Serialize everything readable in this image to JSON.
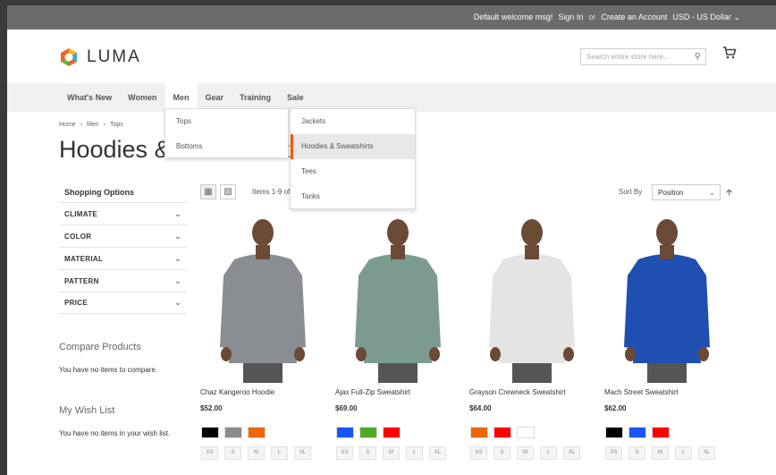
{
  "topbar": {
    "welcome": "Default welcome msg!",
    "sign_in": "Sign In",
    "or": "or",
    "create_account": "Create an Account",
    "currency": "USD - US Dollar"
  },
  "header": {
    "logo_text": "LUMA",
    "search_placeholder": "Search entire store here...",
    "logo_colors": [
      "#f26322",
      "#38a9e4",
      "#6cb33f",
      "#f6b91a"
    ]
  },
  "nav": {
    "items": [
      {
        "label": "What's New"
      },
      {
        "label": "Women"
      },
      {
        "label": "Men"
      },
      {
        "label": "Gear"
      },
      {
        "label": "Training"
      },
      {
        "label": "Sale"
      }
    ],
    "active": "Men",
    "accent": "#ff5501"
  },
  "submenu": {
    "left": [
      "Tops",
      "Bottoms"
    ],
    "right": [
      "Jackets",
      "Hoodies & Sweatshirts",
      "Tees",
      "Tanks"
    ],
    "selected": "Hoodies & Sweatshirts"
  },
  "breadcrumb": [
    "Home",
    "Men",
    "Tops"
  ],
  "page_title": "Hoodies & Sweatshirts",
  "sidebar": {
    "heading": "Shopping Options",
    "filters": [
      "CLIMATE",
      "COLOR",
      "MATERIAL",
      "PATTERN",
      "PRICE"
    ],
    "compare_title": "Compare Products",
    "compare_text": "You have no items to compare.",
    "wishlist_title": "My Wish List",
    "wishlist_text": "You have no items in your wish list."
  },
  "toolbar": {
    "items_count": "Items 1-9 of 13",
    "sort_label": "Sort By",
    "sort_value": "Position"
  },
  "products": [
    {
      "name": "Chaz Kangeroo Hoodie",
      "price": "$52.00",
      "swatches": [
        "#000000",
        "#8c8c8c",
        "#eb6703"
      ],
      "shirt": "#8a8d91",
      "sleeve": "#8a8d91"
    },
    {
      "name": "Ajax Full-Zip Sweatshirt",
      "price": "$69.00",
      "swatches": [
        "#1857f7",
        "#53a828",
        "#ff0000"
      ],
      "shirt": "#7c9a90",
      "sleeve": "#7c9a90"
    },
    {
      "name": "Grayson Crewneck Sweatshirt",
      "price": "$64.00",
      "swatches": [
        "#eb6703",
        "#ff0000",
        "#ffffff"
      ],
      "shirt": "#e4e4e4",
      "sleeve": "#e4e4e4"
    },
    {
      "name": "Mach Street Sweatshirt",
      "price": "$62.00",
      "swatches": [
        "#000000",
        "#1857f7",
        "#ff0000"
      ],
      "shirt": "#1f4fb0",
      "sleeve": "#1f4fb0"
    }
  ],
  "sizes": [
    "XS",
    "S",
    "M",
    "L",
    "XL"
  ]
}
